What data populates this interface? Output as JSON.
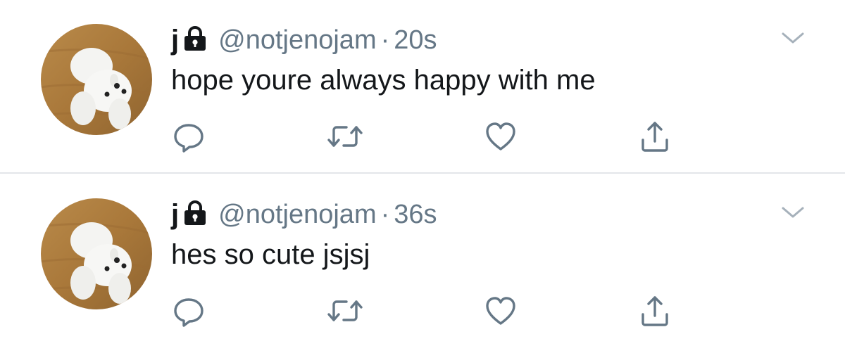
{
  "colors": {
    "text_primary": "#14171a",
    "text_secondary": "#657786",
    "icon": "#657786",
    "divider": "#e3e6e9"
  },
  "tweets": [
    {
      "display_name": "j",
      "handle": "@notjenojam",
      "separator": "·",
      "time": "20s",
      "text": "hope youre always happy with me",
      "icons": [
        "lock-icon",
        "chevron-down-icon",
        "reply-icon",
        "retweet-icon",
        "like-icon",
        "share-icon"
      ]
    },
    {
      "display_name": "j",
      "handle": "@notjenojam",
      "separator": "·",
      "time": "36s",
      "text": "hes so cute jsjsj",
      "icons": [
        "lock-icon",
        "chevron-down-icon",
        "reply-icon",
        "retweet-icon",
        "like-icon",
        "share-icon"
      ]
    }
  ]
}
